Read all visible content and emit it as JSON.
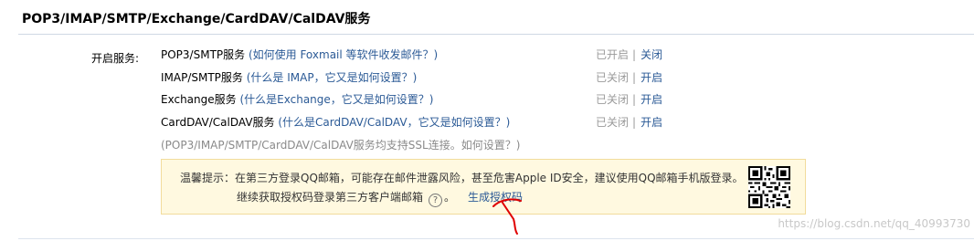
{
  "section": {
    "title": "POP3/IMAP/SMTP/Exchange/CardDAV/CalDAV服务"
  },
  "services": {
    "label": "开启服务:",
    "rows": [
      {
        "name": "POP3/SMTP服务",
        "help": " (如何使用 Foxmail 等软件收发邮件？)",
        "state": "已开启",
        "separator": "|",
        "action": "关闭"
      },
      {
        "name": "IMAP/SMTP服务",
        "help": " (什么是 IMAP，它又是如何设置？)",
        "state": "已关闭",
        "separator": "|",
        "action": "开启"
      },
      {
        "name": "Exchange服务",
        "help": " (什么是Exchange，它又是如何设置？)",
        "state": "已关闭",
        "separator": "|",
        "action": "开启"
      },
      {
        "name": "CardDAV/CalDAV服务",
        "help": " (什么是CardDAV/CalDAV，它又是如何设置？)",
        "state": "已关闭",
        "separator": "|",
        "action": "开启"
      }
    ],
    "ssl_note": "(POP3/IMAP/SMTP/CardDAV/CalDAV服务均支持SSL连接。如何设置？)"
  },
  "tip": {
    "line1": "温馨提示：在第三方登录QQ邮箱，可能存在邮件泄露风险，甚至危害Apple ID安全，建议使用QQ邮箱手机版登录。",
    "line2": "继续获取授权码登录第三方客户端邮箱",
    "help_icon": "?",
    "line2_end": "。",
    "generate_link": "生成授权码",
    "qr_icon": "qr-code-icon"
  },
  "watermark": "https://blog.csdn.net/qq_40993730",
  "colors": {
    "link": "#2b5a96",
    "tip_background": "#fff9e0",
    "tip_border": "#f2dc9c",
    "annotation": "#e00000"
  }
}
